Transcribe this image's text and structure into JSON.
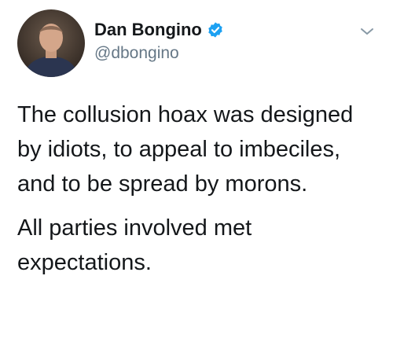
{
  "author": {
    "display_name": "Dan Bongino",
    "handle": "@dbongino",
    "verified": true
  },
  "tweet": {
    "paragraphs": [
      "The collusion hoax was designed by idiots, to appeal to imbeciles, and to be spread by morons.",
      "All parties involved met expectations."
    ]
  },
  "icons": {
    "verified": "verified-badge-icon",
    "menu": "chevron-down-icon",
    "avatar": "profile-photo"
  },
  "colors": {
    "text": "#14171a",
    "secondary": "#657786",
    "verified": "#1da1f2",
    "background": "#ffffff"
  }
}
